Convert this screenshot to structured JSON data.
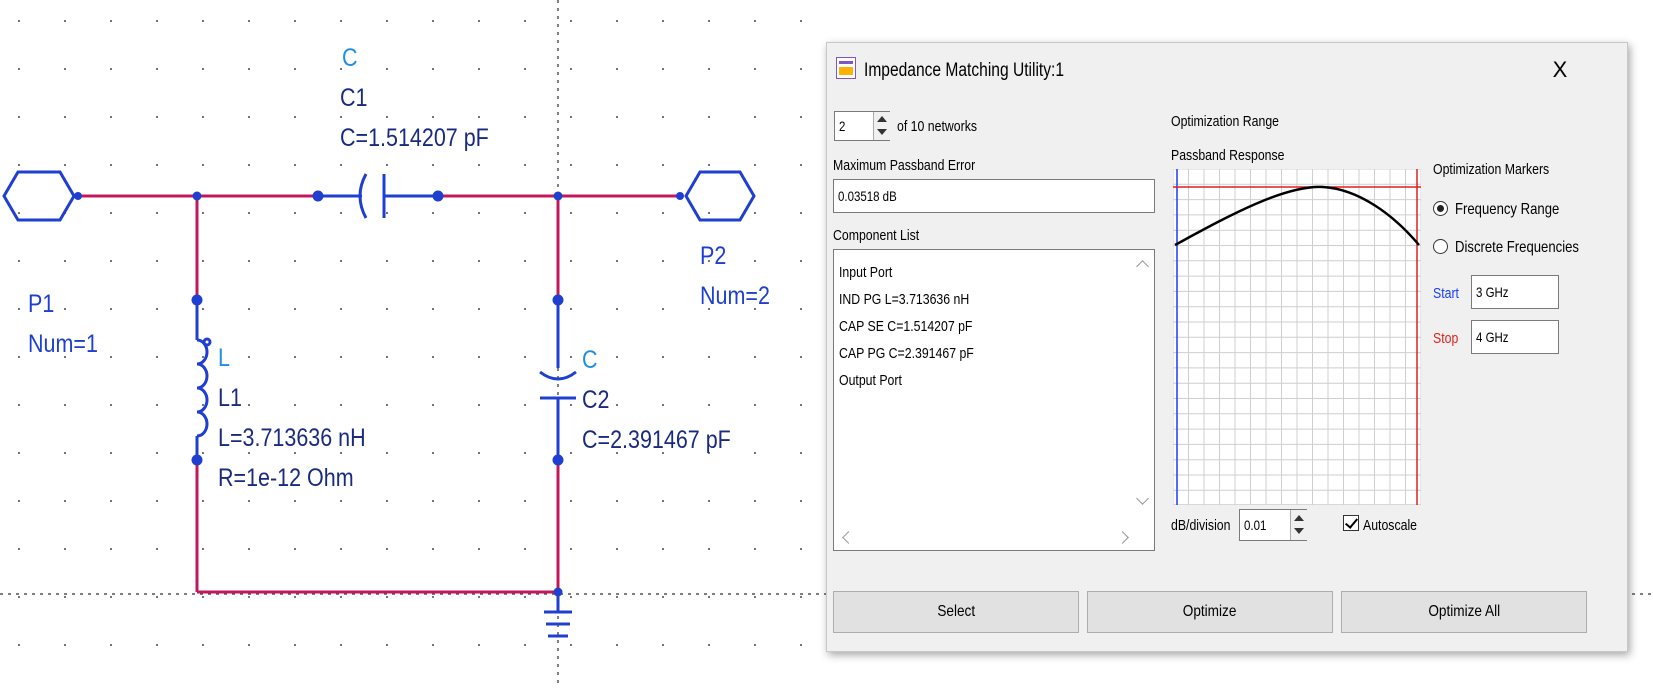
{
  "schematic": {
    "p1": {
      "name": "P1",
      "num": "Num=1"
    },
    "p2": {
      "name": "P2",
      "num": "Num=2"
    },
    "c1": {
      "type": "C",
      "name": "C1",
      "value": "C=1.514207 pF"
    },
    "l1": {
      "type": "L",
      "name": "L1",
      "value": "L=3.713636 nH",
      "resistance": "R=1e-12 Ohm"
    },
    "c2": {
      "type": "C",
      "name": "C2",
      "value": "C=2.391467 pF"
    },
    "colors": {
      "wire": "#c2185b",
      "component": "#1f3fd0",
      "label": "#1a2a80"
    }
  },
  "dialog": {
    "title": "Impedance Matching Utility:1",
    "close": "X",
    "network_index": "2",
    "network_count_text": "of 10 networks",
    "max_passband_error_label": "Maximum Passband Error",
    "max_passband_error_value": "0.03518 dB",
    "component_list_label": "Component List",
    "component_list": [
      "Input Port",
      "IND PG L=3.713636 nH",
      "CAP SE C=1.514207 pF",
      "CAP PG C=2.391467 pF",
      "Output Port"
    ],
    "optimization_range_label": "Optimization Range",
    "passband_response_label": "Passband Response",
    "optimization_markers_label": "Optimization Markers",
    "radio_frequency_range": "Frequency Range",
    "radio_discrete_frequencies": "Discrete Frequencies",
    "selected_marker": "Frequency Range",
    "start_label": "Start",
    "start_value": "3 GHz",
    "stop_label": "Stop",
    "stop_value": "4 GHz",
    "db_division_label": "dB/division",
    "db_division_value": "0.01",
    "autoscale_label": "Autoscale",
    "autoscale_checked": true,
    "buttons": {
      "select": "Select",
      "optimize": "Optimize",
      "optimize_all": "Optimize All"
    },
    "colors": {
      "start": "#1a3cff",
      "stop": "#e0201c",
      "grid": "#c8c8c8",
      "curve": "#000000"
    }
  }
}
